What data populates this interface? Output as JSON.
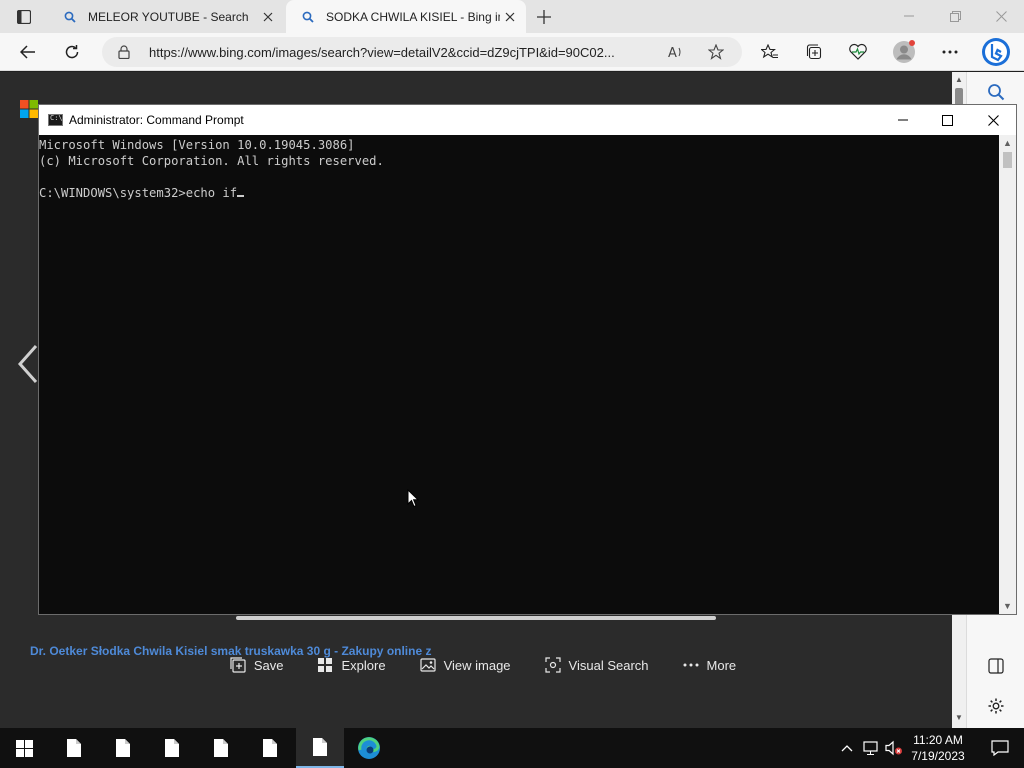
{
  "browser": {
    "tabs": [
      {
        "title": "MELEOR YOUTUBE - Search",
        "active": false
      },
      {
        "title": "SODKA CHWILA KISIEL - Bing im",
        "active": true
      }
    ],
    "url": "https://www.bing.com/images/search?view=detailV2&ccid=dZ9cjTPI&id=90C02..."
  },
  "bing": {
    "actions": [
      {
        "label": "Save",
        "icon": "add-to-collection-icon"
      },
      {
        "label": "Explore",
        "icon": "grid-icon"
      },
      {
        "label": "View image",
        "icon": "image-icon"
      },
      {
        "label": "Visual Search",
        "icon": "visual-search-icon"
      },
      {
        "label": "More",
        "icon": "more-icon"
      }
    ],
    "result_link": "Dr. Oetker Słodka Chwila Kisiel smak truskawka 30 g - Zakupy online z"
  },
  "cmd": {
    "title": "Administrator: Command Prompt",
    "icon_text": "C:\\",
    "lines": [
      "Microsoft Windows [Version 10.0.19045.3086]",
      "(c) Microsoft Corporation. All rights reserved.",
      "",
      "C:\\WINDOWS\\system32>echo if"
    ]
  },
  "taskbar": {
    "time": "11:20 AM",
    "date": "7/19/2023"
  },
  "colors": {
    "console_bg": "#0c0c0c",
    "console_text": "#cccccc",
    "link": "#4e8ad8",
    "taskbar_bg": "#101010"
  }
}
